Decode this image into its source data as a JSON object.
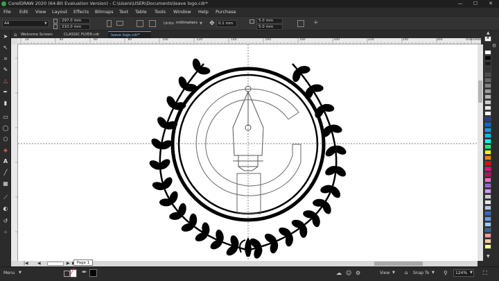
{
  "window": {
    "title": "CorelDRAW 2020 (64-Bit Evaluation Version) - C:\\Users\\USER\\Documents\\leave logo.cdr*",
    "minimize": "—",
    "maximize": "☐",
    "close": "✕"
  },
  "menu": [
    "File",
    "Edit",
    "View",
    "Layout",
    "Effects",
    "Bitmaps",
    "Text",
    "Table",
    "Tools",
    "Window",
    "Help",
    "Purchase"
  ],
  "propbar": {
    "page_size": "A4",
    "width": "297.0 mm",
    "height": "210.0 mm",
    "units_label": "Units:",
    "units": "millimeters",
    "nudge": "0.1 mm",
    "dup_x": "5.0 mm",
    "dup_y": "5.0 mm",
    "add": "+"
  },
  "tabs": [
    "Welcome Screen",
    "CLASSIC FLYER.cdr",
    "leave logo.cdr*"
  ],
  "ruler": {
    "labels": [
      "20",
      "40",
      "60",
      "80",
      "100",
      "120",
      "140",
      "160",
      "180",
      "200",
      "220",
      "240",
      "260"
    ],
    "units": "millimeters"
  },
  "page_nav": {
    "page_label": "Page 1"
  },
  "status": {
    "menu_label": "Menu",
    "view_label": "View",
    "snap_label": "Snap To",
    "zoom": "124%"
  },
  "colors": {
    "ui_dark": "#2b2b2b",
    "accent": "#4aa3ff",
    "canvas": "#ffffff",
    "logo": "#000000"
  },
  "palette": [
    "#ffffff",
    "#000000",
    "#1a1a1a",
    "#333333",
    "#4d4d4d",
    "#666666",
    "#808080",
    "#999999",
    "#b3b3b3",
    "#cccccc",
    "#e6e6e6",
    "#f2f2f2",
    "#1e3f99",
    "#0066ff",
    "#00a0e9",
    "#00c0ff",
    "#00ffff",
    "#00ff80",
    "#ffff00",
    "#ff8000",
    "#ff0000",
    "#ff0080",
    "#cc0066",
    "#ff66cc",
    "#9966cc",
    "#cc99ff",
    "#cccccc",
    "#e6e6e6",
    "#b3c7e6",
    "#3366cc",
    "#6699ff",
    "#99ccff",
    "#336699",
    "#ff9999",
    "#ffcc99",
    "#ffff99"
  ]
}
